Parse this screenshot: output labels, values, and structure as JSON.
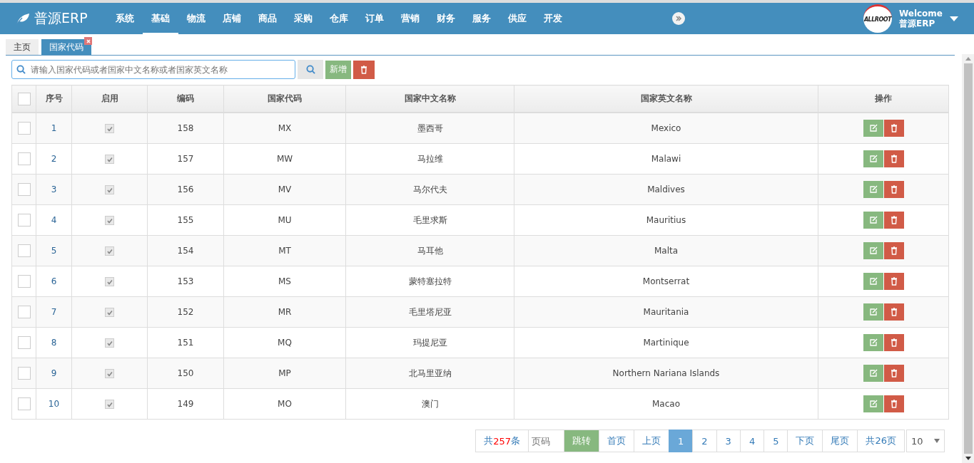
{
  "header": {
    "brand": "普源ERP",
    "nav": [
      {
        "label": "系统",
        "selected": false
      },
      {
        "label": "基础",
        "selected": true
      },
      {
        "label": "物流",
        "selected": false
      },
      {
        "label": "店铺",
        "selected": false
      },
      {
        "label": "商品",
        "selected": false
      },
      {
        "label": "采购",
        "selected": false
      },
      {
        "label": "仓库",
        "selected": false
      },
      {
        "label": "订单",
        "selected": false
      },
      {
        "label": "营销",
        "selected": false
      },
      {
        "label": "财务",
        "selected": false
      },
      {
        "label": "服务",
        "selected": false
      },
      {
        "label": "供应",
        "selected": false
      },
      {
        "label": "开发",
        "selected": false
      }
    ],
    "logo_text": "ALLROOT",
    "welcome": "Welcome",
    "user": "普源ERP"
  },
  "tabs": [
    {
      "label": "主页",
      "selected": false,
      "closable": false
    },
    {
      "label": "国家代码",
      "selected": true,
      "closable": true
    }
  ],
  "toolbar": {
    "search_placeholder": "请输入国家代码或者国家中文名称或者国家英文名称",
    "add_label": "新增"
  },
  "table": {
    "select_all_checked": false,
    "columns": [
      "序号",
      "启用",
      "编码",
      "国家代码",
      "国家中文名称",
      "国家英文名称",
      "操作"
    ],
    "rows": [
      {
        "checked": false,
        "index": "1",
        "enabled": true,
        "code": "158",
        "country_code": "MX",
        "name_cn": "墨西哥",
        "name_en": "Mexico"
      },
      {
        "checked": false,
        "index": "2",
        "enabled": true,
        "code": "157",
        "country_code": "MW",
        "name_cn": "马拉维",
        "name_en": "Malawi"
      },
      {
        "checked": false,
        "index": "3",
        "enabled": true,
        "code": "156",
        "country_code": "MV",
        "name_cn": "马尔代夫",
        "name_en": "Maldives"
      },
      {
        "checked": false,
        "index": "4",
        "enabled": true,
        "code": "155",
        "country_code": "MU",
        "name_cn": "毛里求斯",
        "name_en": "Mauritius"
      },
      {
        "checked": false,
        "index": "5",
        "enabled": true,
        "code": "154",
        "country_code": "MT",
        "name_cn": "马耳他",
        "name_en": "Malta"
      },
      {
        "checked": false,
        "index": "6",
        "enabled": true,
        "code": "153",
        "country_code": "MS",
        "name_cn": "蒙特塞拉特",
        "name_en": "Montserrat"
      },
      {
        "checked": false,
        "index": "7",
        "enabled": true,
        "code": "152",
        "country_code": "MR",
        "name_cn": "毛里塔尼亚",
        "name_en": "Mauritania"
      },
      {
        "checked": false,
        "index": "8",
        "enabled": true,
        "code": "151",
        "country_code": "MQ",
        "name_cn": "玛提尼亚",
        "name_en": "Martinique"
      },
      {
        "checked": false,
        "index": "9",
        "enabled": true,
        "code": "150",
        "country_code": "MP",
        "name_cn": "北马里亚纳",
        "name_en": "Northern Nariana Islands"
      },
      {
        "checked": false,
        "index": "10",
        "enabled": true,
        "code": "149",
        "country_code": "MO",
        "name_cn": "澳门",
        "name_en": "Macao"
      }
    ]
  },
  "pagination": {
    "total_prefix": "共",
    "total_count": "257",
    "total_suffix": "条",
    "page_placeholder": "页码",
    "jump": "跳转",
    "first": "首页",
    "prev": "上页",
    "pages": [
      {
        "label": "1",
        "selected": true
      },
      {
        "label": "2",
        "selected": false
      },
      {
        "label": "3",
        "selected": false
      },
      {
        "label": "4",
        "selected": false
      },
      {
        "label": "5",
        "selected": false
      }
    ],
    "next": "下页",
    "last": "尾页",
    "page_count": "共26页",
    "page_size": "10"
  }
}
